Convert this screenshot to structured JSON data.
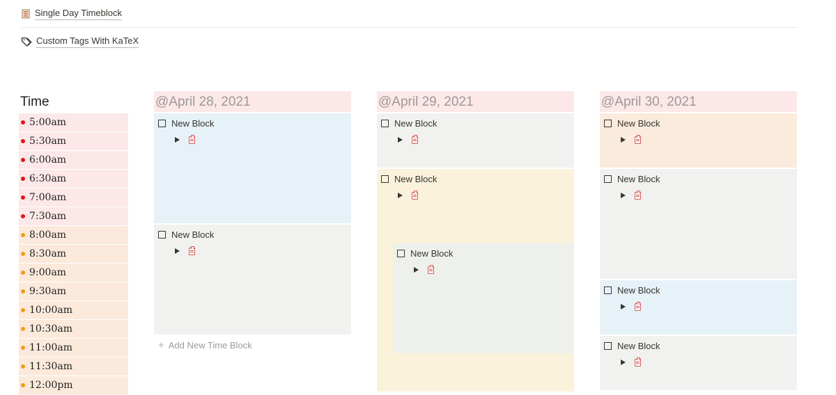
{
  "links": {
    "timeblock": {
      "icon": "page-icon",
      "label": "Single Day Timeblock"
    },
    "tags": {
      "icon": "tag-icon",
      "label": "Custom Tags With KaTeX"
    }
  },
  "time_column": {
    "header": "Time",
    "slots": [
      {
        "label": "5:00am",
        "color": "red"
      },
      {
        "label": "5:30am",
        "color": "red"
      },
      {
        "label": "6:00am",
        "color": "red"
      },
      {
        "label": "6:30am",
        "color": "red"
      },
      {
        "label": "7:00am",
        "color": "red"
      },
      {
        "label": "7:30am",
        "color": "red"
      },
      {
        "label": "8:00am",
        "color": "orange"
      },
      {
        "label": "8:30am",
        "color": "orange"
      },
      {
        "label": "9:00am",
        "color": "orange"
      },
      {
        "label": "9:30am",
        "color": "orange"
      },
      {
        "label": "10:00am",
        "color": "orange"
      },
      {
        "label": "10:30am",
        "color": "orange"
      },
      {
        "label": "11:00am",
        "color": "orange"
      },
      {
        "label": "11:30am",
        "color": "orange"
      },
      {
        "label": "12:00pm",
        "color": "orange"
      }
    ]
  },
  "colors": {
    "red_dot": "#e3141c",
    "orange_dot": "#f59a1a",
    "date_header_bg": "#fce8e8"
  },
  "days": [
    {
      "date": "@April 28, 2021",
      "blocks": [
        {
          "title": "New Block",
          "color": "blue"
        },
        {
          "title": "New Block",
          "color": "gray"
        }
      ],
      "add_label": "Add New Time Block"
    },
    {
      "date": "@April 29, 2021",
      "blocks": [
        {
          "title": "New Block",
          "color": "gray"
        },
        {
          "title": "New Block",
          "color": "yellow"
        },
        {
          "title": "New Block",
          "color": "mint"
        }
      ]
    },
    {
      "date": "@April 30, 2021",
      "blocks": [
        {
          "title": "New Block",
          "color": "peach"
        },
        {
          "title": "New Block",
          "color": "gray"
        },
        {
          "title": "New Block",
          "color": "blue"
        },
        {
          "title": "New Block",
          "color": "gray"
        }
      ]
    }
  ]
}
